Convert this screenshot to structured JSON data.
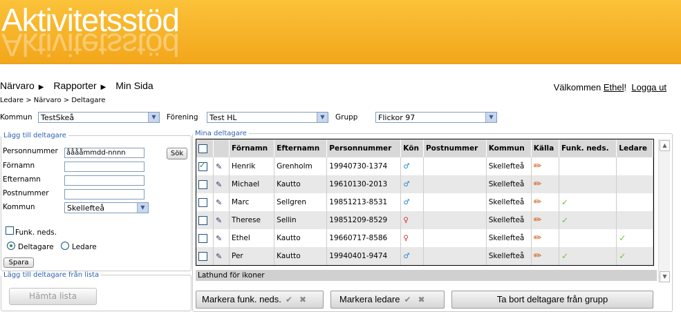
{
  "app": {
    "title": "Aktivitetsstöd"
  },
  "nav": {
    "items": [
      "Närvaro",
      "Rapporter",
      "Min Sida"
    ]
  },
  "welcome": {
    "prefix": "Välkommen",
    "user": "Ethel",
    "suffix": "!",
    "logout": "Logga ut"
  },
  "breadcrumb": "Ledare > Närvaro > Deltagare",
  "filters": {
    "kommun_label": "Kommun",
    "kommun_value": "TestSkeå",
    "forening_label": "Förening",
    "forening_value": "Test HL",
    "grupp_label": "Grupp",
    "grupp_value": "Flickor 97"
  },
  "add_form": {
    "legend": "Lägg till deltagare",
    "personnummer_label": "Personnummer",
    "personnummer_value": "ååååmmdd-nnnn",
    "search_button": "Sök",
    "fornamn_label": "Förnamn",
    "efternamn_label": "Efternamn",
    "postnummer_label": "Postnummer",
    "kommun_label": "Kommun",
    "kommun_value": "Skellefteå",
    "funk_label": "Funk. neds.",
    "radio_deltagare": "Deltagare",
    "radio_ledare": "Ledare",
    "save_button": "Spara"
  },
  "add_list": {
    "legend": "Lägg till deltagare från lista",
    "fetch_button": "Hämta lista"
  },
  "participants": {
    "legend": "Mina deltagare",
    "columns": [
      "Förnamn",
      "Efternamn",
      "Personnummer",
      "Kön",
      "Postnummer",
      "Kommun",
      "Källa",
      "Funk. neds.",
      "Ledare"
    ],
    "rows": [
      {
        "checked": true,
        "fornamn": "Henrik",
        "efternamn": "Grenholm",
        "personnummer": "19940730-1374",
        "kon": "male",
        "postnummer": "",
        "kommun": "Skellefteå",
        "funk": false,
        "ledare": false
      },
      {
        "checked": false,
        "fornamn": "Michael",
        "efternamn": "Kautto",
        "personnummer": "19610130-2013",
        "kon": "male",
        "postnummer": "",
        "kommun": "Skellefteå",
        "funk": false,
        "ledare": false
      },
      {
        "checked": false,
        "fornamn": "Marc",
        "efternamn": "Sellgren",
        "personnummer": "19851213-8531",
        "kon": "male",
        "postnummer": "",
        "kommun": "Skellefteå",
        "funk": true,
        "ledare": false
      },
      {
        "checked": false,
        "fornamn": "Therese",
        "efternamn": "Sellin",
        "personnummer": "19851209-8529",
        "kon": "female",
        "postnummer": "",
        "kommun": "Skellefteå",
        "funk": true,
        "ledare": false
      },
      {
        "checked": false,
        "fornamn": "Ethel",
        "efternamn": "Kautto",
        "personnummer": "19660717-8586",
        "kon": "female",
        "postnummer": "",
        "kommun": "Skellefteå",
        "funk": false,
        "ledare": true
      },
      {
        "checked": false,
        "fornamn": "Per",
        "efternamn": "Kautto",
        "personnummer": "19940401-9474",
        "kon": "male",
        "postnummer": "",
        "kommun": "Skellefteå",
        "funk": true,
        "ledare": true
      }
    ]
  },
  "lathund": "Lathund för ikoner",
  "actions": {
    "mark_funk": "Markera funk. neds.",
    "mark_ledare": "Markera ledare",
    "remove": "Ta bort deltagare från grupp"
  }
}
